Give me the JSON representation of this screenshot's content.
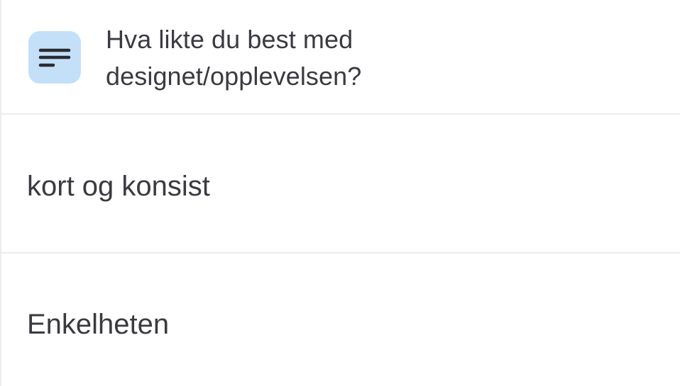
{
  "question": {
    "icon": "text-lines-icon",
    "icon_bg_color": "#c4e0f8",
    "icon_fg_color": "#2b2b30",
    "title_line1": "Hva likte du best med",
    "title_line2": "designet/opplevelsen?"
  },
  "answers": [
    {
      "text": "kort og konsist"
    },
    {
      "text": "Enkelheten"
    }
  ]
}
